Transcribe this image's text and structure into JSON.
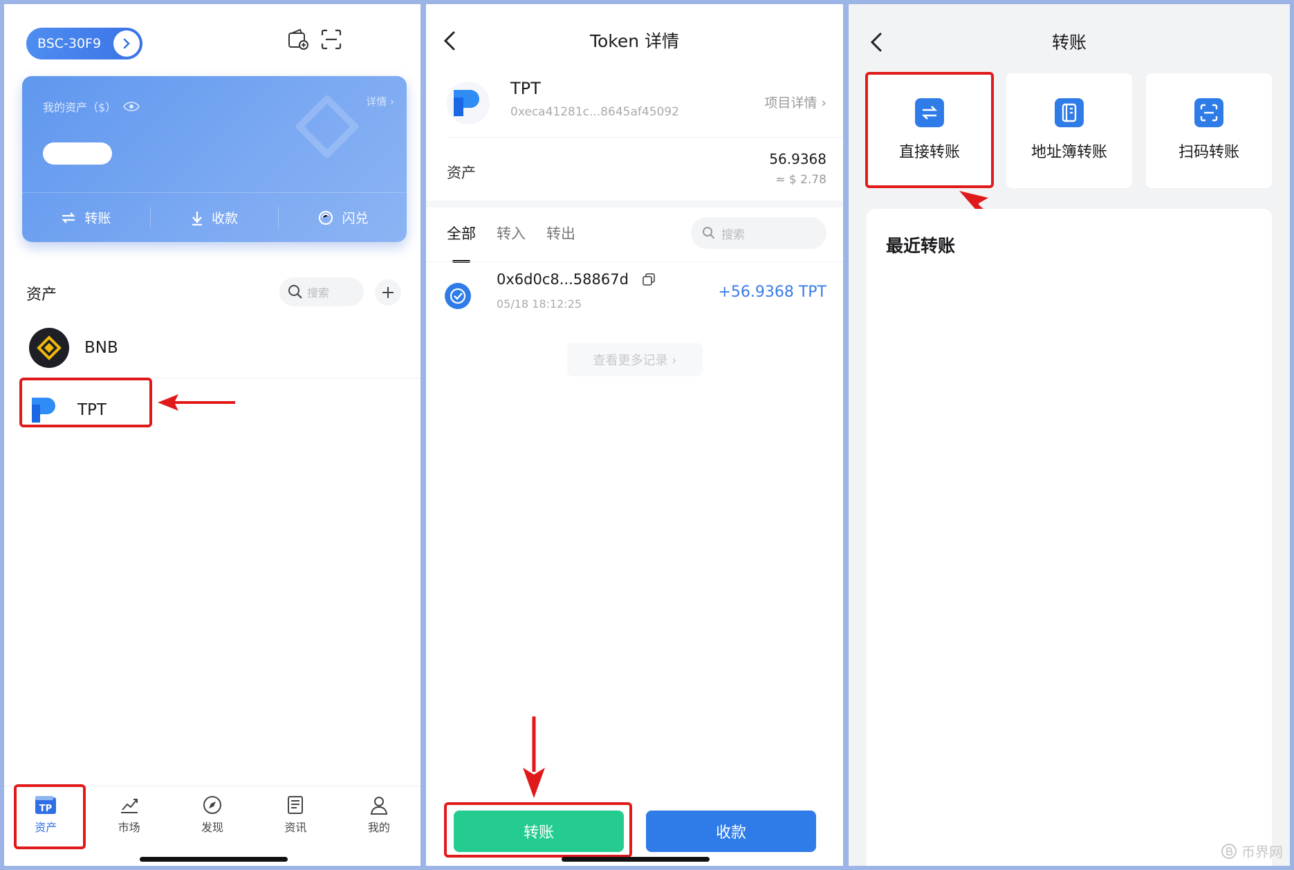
{
  "wallet": {
    "network_pill": "BSC-30F9",
    "asset_card": {
      "label": "我的资产（$）",
      "detail_link": "详情 ›",
      "actions": [
        "转账",
        "收款",
        "闪兑"
      ]
    },
    "assets_title": "资产",
    "search_placeholder": "搜索",
    "tokens": [
      "BNB",
      "TPT"
    ],
    "nav": [
      {
        "label": "资产",
        "icon": "wallet-tp-icon"
      },
      {
        "label": "市场",
        "icon": "market-chart-icon"
      },
      {
        "label": "发现",
        "icon": "compass-icon"
      },
      {
        "label": "资讯",
        "icon": "news-icon"
      },
      {
        "label": "我的",
        "icon": "user-icon"
      }
    ]
  },
  "token_detail": {
    "title": "Token 详情",
    "token_name": "TPT",
    "token_address": "0xeca41281c...8645af45092",
    "project_link": "项目详情 ›",
    "asset_label": "资产",
    "balance": "56.9368",
    "balance_usd": "≈ $ 2.78",
    "tabs": [
      "全部",
      "转入",
      "转出"
    ],
    "search_placeholder": "搜索",
    "transactions": [
      {
        "address": "0x6d0c8...58867d",
        "time": "05/18 18:12:25",
        "amount": "+56.9368 TPT"
      }
    ],
    "more_records": "查看更多记录 ›",
    "send_button": "转账",
    "receive_button": "收款"
  },
  "transfer": {
    "title": "转账",
    "options": [
      "直接转账",
      "地址簿转账",
      "扫码转账"
    ],
    "recent_title": "最近转账",
    "watermark": "币界网"
  },
  "colors": {
    "accent_blue": "#2f7ce8",
    "send_green": "#25cc8f",
    "highlight_red": "#e01a1a",
    "border_blue": "#9db4e6"
  }
}
